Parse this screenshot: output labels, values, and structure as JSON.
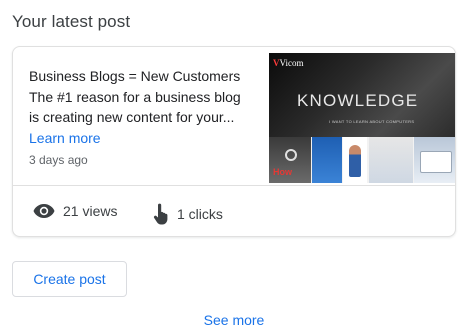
{
  "section": {
    "title": "Your latest post"
  },
  "post": {
    "lines": [
      "Business Blogs = New Customers",
      "The #1 reason for a business blog",
      "is creating new content for your..."
    ],
    "learn_more": "Learn more",
    "date": "3 days ago",
    "thumbnail": {
      "logo": "Vicom",
      "headline": "KNOWLEDGE",
      "tagline": "I WANT TO LEARN ABOUT COMPUTERS",
      "tile_word": "How"
    }
  },
  "stats": {
    "views": "21 views",
    "clicks": "1 clicks",
    "views_icon": "eye-icon",
    "clicks_icon": "touch-hand-icon"
  },
  "actions": {
    "create_post": "Create post",
    "see_more": "See more"
  },
  "colors": {
    "link": "#1a73e8",
    "text": "#202124",
    "secondary_text": "#5f6368",
    "border": "#e0e0e0"
  }
}
